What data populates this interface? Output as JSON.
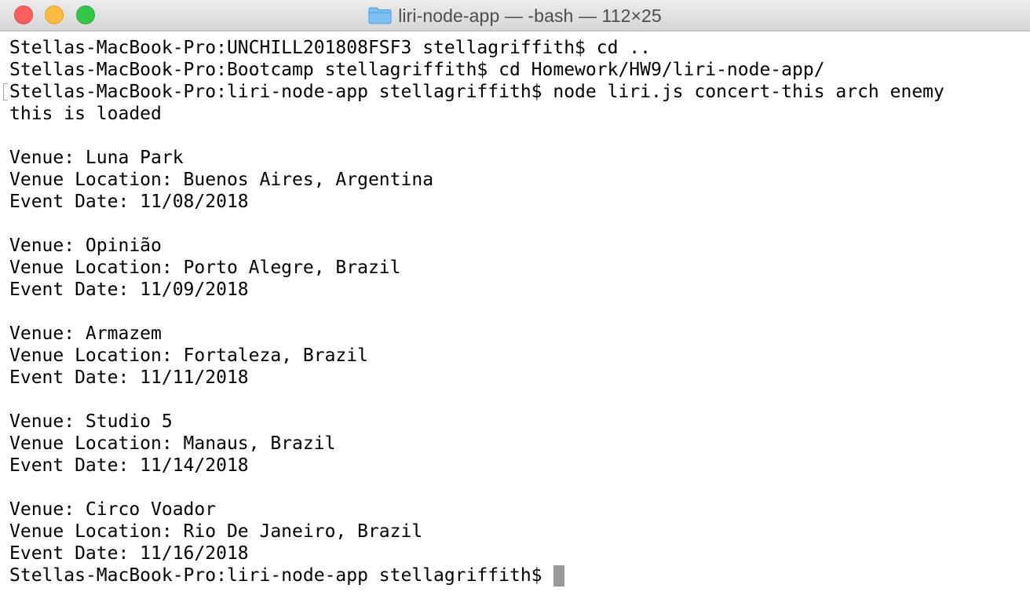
{
  "window": {
    "title": "liri-node-app — -bash — 112×25",
    "folder_icon": "folder-icon"
  },
  "terminal": {
    "lines": [
      "Stellas-MacBook-Pro:UNCHILL201808FSF3 stellagriffith$ cd ..",
      "Stellas-MacBook-Pro:Bootcamp stellagriffith$ cd Homework/HW9/liri-node-app/",
      "Stellas-MacBook-Pro:liri-node-app stellagriffith$ node liri.js concert-this arch enemy",
      "this is loaded",
      "",
      "Venue: Luna Park",
      "Venue Location: Buenos Aires, Argentina",
      "Event Date: 11/08/2018",
      "",
      "Venue: Opinião",
      "Venue Location: Porto Alegre, Brazil",
      "Event Date: 11/09/2018",
      "",
      "Venue: Armazem",
      "Venue Location: Fortaleza, Brazil",
      "Event Date: 11/11/2018",
      "",
      "Venue: Studio 5",
      "Venue Location: Manaus, Brazil",
      "Event Date: 11/14/2018",
      "",
      "Venue: Circo Voador",
      "Venue Location: Rio De Janeiro, Brazil",
      "Event Date: 11/16/2018"
    ],
    "prompt": "Stellas-MacBook-Pro:liri-node-app stellagriffith$"
  },
  "colors": {
    "close": "#fc605c",
    "minimize": "#fdbc40",
    "maximize": "#34c84a",
    "folder": "#5aaef0",
    "cursor": "#999999"
  }
}
